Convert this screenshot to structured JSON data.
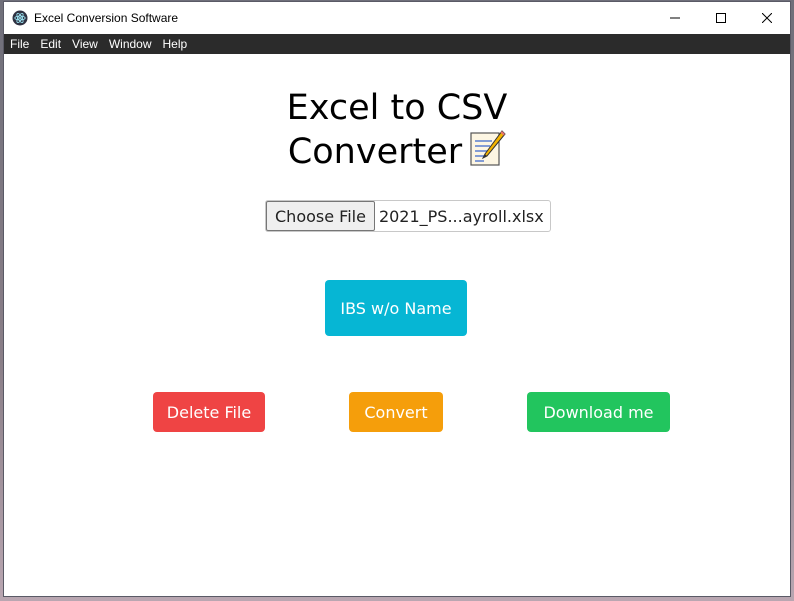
{
  "window": {
    "title": "Excel Conversion Software",
    "app_icon": "electron-icon",
    "controls": [
      "minimize-icon",
      "maximize-icon",
      "close-icon"
    ]
  },
  "menubar": {
    "items": [
      {
        "label": "File"
      },
      {
        "label": "Edit"
      },
      {
        "label": "View"
      },
      {
        "label": "Window"
      },
      {
        "label": "Help"
      }
    ]
  },
  "main": {
    "heading_line1": "Excel to CSV",
    "heading_line2": "Converter",
    "heading_icon": "memo-icon",
    "file_input": {
      "button_label": "Choose File",
      "file_name": "2021_PS...ayroll.xlsx"
    },
    "buttons": {
      "ibs": "IBS w/o Name",
      "delete": "Delete File",
      "convert": "Convert",
      "download": "Download me"
    }
  },
  "colors": {
    "ibs": "#06b6d4",
    "delete": "#ef4444",
    "convert": "#f59e0b",
    "download": "#22c55e",
    "menubar": "#2b2b2b"
  }
}
